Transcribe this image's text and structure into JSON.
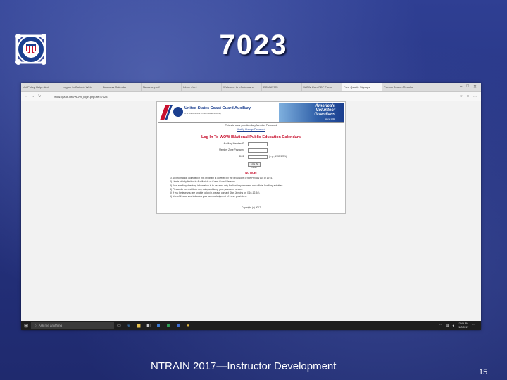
{
  "slide": {
    "title": "7023",
    "footer": "NTRAIN 2017—Instructor Development",
    "page_number": "15"
  },
  "browser": {
    "tabs": [
      {
        "label": "Uni Policy Help - Uni"
      },
      {
        "label": "Log on to Outlook Web"
      },
      {
        "label": "Business Calendar"
      },
      {
        "label": "News.org.pdf"
      },
      {
        "label": "Inbox - Uni"
      },
      {
        "label": "Welcome to eCalendars"
      },
      {
        "label": "ECM ATMS"
      },
      {
        "label": "WOW User PDF Form"
      },
      {
        "label": "Free Quality Signups"
      },
      {
        "label": "Person Search Results"
      }
    ],
    "url": "wow.cgaux.info/WOW_login.php?rel=7023",
    "icons": {
      "back": "back-icon",
      "refresh": "refresh-icon",
      "favorite": "star-icon"
    }
  },
  "webpage": {
    "org_name": "United States Coast Guard Auxiliary",
    "org_subtitle": "U.S. Department of Homeland Security",
    "tagline": [
      "America's",
      "Volunteer",
      "Guardians"
    ],
    "since": "Since 1939",
    "intro": "This site uses your Auxiliary Member Password",
    "change_password": "Modify Change Password",
    "login_title": "Log In To WOW IINational Public Education Calendars",
    "fields": [
      {
        "label": "Auxiliary Member ID",
        "value": ""
      },
      {
        "label": "Member Zone Password",
        "value": ""
      },
      {
        "label": "DOB",
        "value": ""
      }
    ],
    "dob_hint": "(e.g., 1955/1/2/1)",
    "login_button": "LOG IN NOW",
    "notice_title": "NOTICE:",
    "notices": [
      "1) All information collected in this program is covered by the provisions of the Privacy Act of 1974.",
      "2) Use is strictly limited to Auxiliarists or Coast Guard Persons.",
      "3) Your auxiliary directory information is to be used only for Auxiliary business and official Auxiliary activities.",
      "4) Please do not distribute any data, and keep your password secure.",
      "5) If you believe you are unable to log in, please contact Stan Jenkins on (116-12-54).",
      "6) Use of this service indicates your acknowledgment of these provisions."
    ],
    "copyright": "Copyright (c) 2017"
  },
  "taskbar": {
    "search_placeholder": "Ask me anything",
    "time": "12:49 PM",
    "date": "1/7/2017"
  },
  "colors": {
    "slide_bg": "#25327f",
    "usa_red": "#c8102e",
    "usa_blue": "#1b3f8f"
  }
}
